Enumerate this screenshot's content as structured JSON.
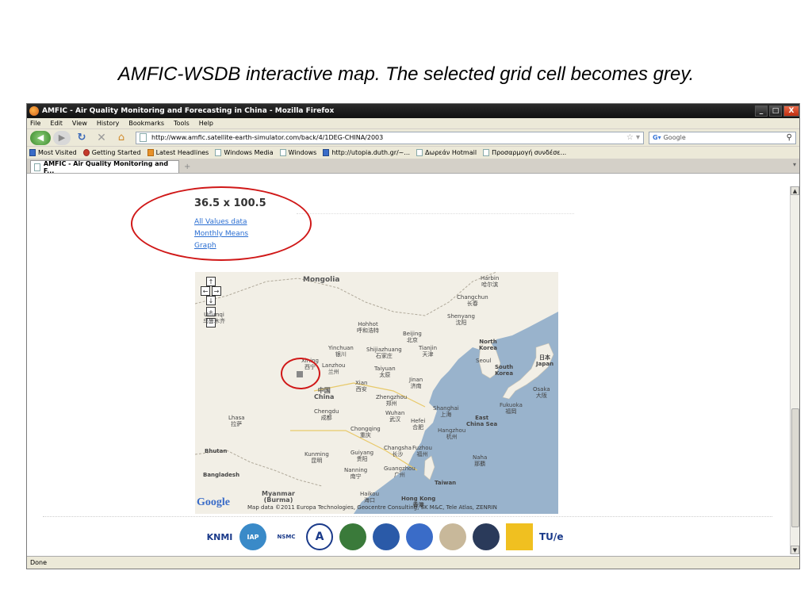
{
  "slide": {
    "caption": "AMFIC-WSDB interactive map. The selected grid cell becomes grey."
  },
  "window": {
    "title": "AMFIC - Air Quality Monitoring and Forecasting in China - Mozilla Firefox",
    "minimize": "_",
    "maximize": "□",
    "close": "X"
  },
  "menu": [
    "File",
    "Edit",
    "View",
    "History",
    "Bookmarks",
    "Tools",
    "Help"
  ],
  "nav": {
    "url": "http://www.amfic.satellite-earth-simulator.com/back/4/1DEG-CHINA/2003",
    "search_placeholder": "Google"
  },
  "bookmarks": [
    {
      "label": "Most Visited",
      "icon": "blue"
    },
    {
      "label": "Getting Started",
      "icon": "red"
    },
    {
      "label": "Latest Headlines",
      "icon": "orange"
    },
    {
      "label": "Windows Media",
      "icon": "page"
    },
    {
      "label": "Windows",
      "icon": "page"
    },
    {
      "label": "http://utopia.duth.gr/~...",
      "icon": "page"
    },
    {
      "label": "Δωρεάν Hotmail",
      "icon": "page"
    },
    {
      "label": "Προσαρμογή συνδέσε...",
      "icon": "page"
    }
  ],
  "tab": {
    "label": "AMFIC - Air Quality Monitoring and F..."
  },
  "content": {
    "coord_title": "36.5 x 100.5",
    "links": [
      "All Values data",
      "Monthly Means",
      "Graph"
    ]
  },
  "map": {
    "labels": [
      {
        "text": "Mongolia",
        "cls": "big"
      },
      {
        "text": "Harbin\n哈尔滨",
        "cls": ""
      },
      {
        "text": "Changchun\n长春",
        "cls": ""
      },
      {
        "text": "Shenyang\n沈阳",
        "cls": ""
      },
      {
        "text": "Urumqi\n乌鲁木齐",
        "cls": ""
      },
      {
        "text": "Hohhot\n呼和浩特",
        "cls": ""
      },
      {
        "text": "Beijing\n北京",
        "cls": ""
      },
      {
        "text": "Tianjin\n天津",
        "cls": ""
      },
      {
        "text": "Shijiazhuang\n石家庄",
        "cls": ""
      },
      {
        "text": "Yinchuan\n银川",
        "cls": ""
      },
      {
        "text": "North\nKorea",
        "cls": ""
      },
      {
        "text": "Seoul",
        "cls": ""
      },
      {
        "text": "South\nKorea",
        "cls": ""
      },
      {
        "text": "日本\nJapan",
        "cls": ""
      },
      {
        "text": "Xining\n西宁",
        "cls": ""
      },
      {
        "text": "Lanzhou\n兰州",
        "cls": ""
      },
      {
        "text": "Taiyuan\n太原",
        "cls": ""
      },
      {
        "text": "Jinan\n济南",
        "cls": ""
      },
      {
        "text": "Xian\n西安",
        "cls": ""
      },
      {
        "text": "中国\nChina",
        "cls": "country"
      },
      {
        "text": "Zhengzhou\n郑州",
        "cls": ""
      },
      {
        "text": "Osaka\n大阪",
        "cls": ""
      },
      {
        "text": "Fukuoka\n福岡",
        "cls": ""
      },
      {
        "text": "Chengdu\n成都",
        "cls": ""
      },
      {
        "text": "Wuhan\n武汉",
        "cls": ""
      },
      {
        "text": "Hefei\n合肥",
        "cls": ""
      },
      {
        "text": "Shanghai\n上海",
        "cls": ""
      },
      {
        "text": "East\nChina Sea",
        "cls": ""
      },
      {
        "text": "Lhasa\n拉萨",
        "cls": ""
      },
      {
        "text": "Chongqing\n重庆",
        "cls": ""
      },
      {
        "text": "Hangzhou\n杭州",
        "cls": ""
      },
      {
        "text": "Bhutan",
        "cls": ""
      },
      {
        "text": "Kunming\n昆明",
        "cls": ""
      },
      {
        "text": "Guiyang\n贵阳",
        "cls": ""
      },
      {
        "text": "Changsha\n长沙",
        "cls": ""
      },
      {
        "text": "Fuzhou\n福州",
        "cls": ""
      },
      {
        "text": "Naha\n那覇",
        "cls": ""
      },
      {
        "text": "Bangladesh",
        "cls": ""
      },
      {
        "text": "Nanning\n南宁",
        "cls": ""
      },
      {
        "text": "Guangzhou\n广州",
        "cls": ""
      },
      {
        "text": "Taiwan",
        "cls": ""
      },
      {
        "text": "Myanmar\n(Burma)",
        "cls": "country"
      },
      {
        "text": "Haikou\n海口",
        "cls": ""
      },
      {
        "text": "Hong Kong\n香港",
        "cls": ""
      }
    ],
    "google": "Google",
    "attribution": "Map data ©2011 Europa Technologies, Geocentre Consulting, SK M&C, Tele Atlas, ZENRIN"
  },
  "footer_logos": [
    "KNMI",
    "IAP",
    "NSMC",
    "A",
    "",
    "",
    "",
    "",
    "",
    "",
    "TU/e"
  ],
  "status": "Done",
  "colors": {
    "annotation": "#d01818",
    "link": "#2a6ed2",
    "sea": "#99b3cc",
    "land": "#f2efe6"
  }
}
